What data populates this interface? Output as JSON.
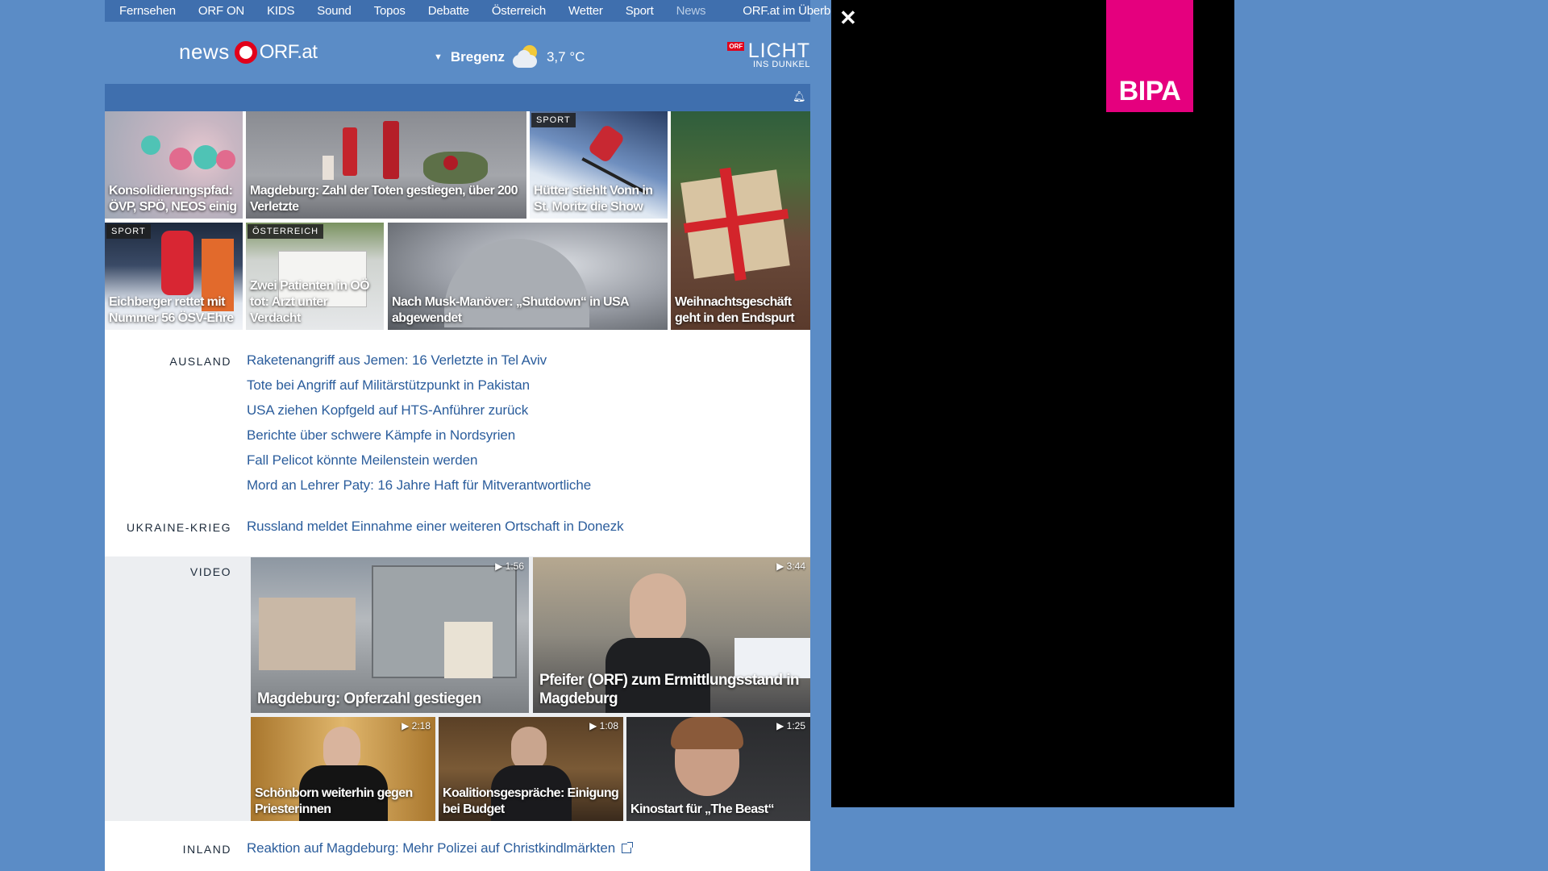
{
  "topnav": {
    "items": [
      "Fernsehen",
      "ORF ON",
      "KIDS",
      "Sound",
      "Topos",
      "Debatte",
      "Österreich",
      "Wetter",
      "Sport",
      "News"
    ],
    "active": "News",
    "overview": "ORF.at im Überblick"
  },
  "header": {
    "logo_news": "news",
    "logo_orfat": "ORF.at",
    "weather_city": "Bregenz",
    "weather_temp": "3,7 °C",
    "weather_icon": "partly-cloudy-icon",
    "campaign_badge": "ORF",
    "campaign_title": "LICHT",
    "campaign_sub": "INS DUNKEL"
  },
  "tiles": [
    {
      "caption": "Konsolidierungspfad: ÖVP, SPÖ, NEOS einig",
      "tag": ""
    },
    {
      "caption": "Magdeburg: Zahl der Toten gestiegen, über 200 Verletzte",
      "tag": ""
    },
    {
      "caption": "Hütter stiehlt Vonn in St. Moritz die Show",
      "tag": "SPORT"
    },
    {
      "caption": "Weihnachtsgeschäft geht in den Endspurt",
      "tag": ""
    },
    {
      "caption": "Eichberger rettet mit Nummer 56 ÖSV-Ehre",
      "tag": "SPORT"
    },
    {
      "caption": "Zwei Patienten in OÖ tot: Arzt unter Verdacht",
      "tag": "ÖSTERREICH"
    },
    {
      "caption": "Nach Musk-Manöver: „Shutdown“ in USA abgewendet",
      "tag": ""
    }
  ],
  "sections": {
    "ausland": {
      "label": "AUSLAND",
      "items": [
        "Raketenangriff aus Jemen: 16 Verletzte in Tel Aviv",
        "Tote bei Angriff auf Militärstützpunkt in Pakistan",
        "USA ziehen Kopfgeld auf HTS-Anführer zurück",
        "Berichte über schwere Kämpfe in Nordsyrien",
        "Fall Pelicot könnte Meilenstein werden",
        "Mord an Lehrer Paty: 16 Jahre Haft für Mitverantwortliche"
      ]
    },
    "ukraine": {
      "label": "UKRAINE-KRIEG",
      "items": [
        "Russland meldet Einnahme einer weiteren Ortschaft in Donezk"
      ]
    },
    "video": {
      "label": "VIDEO",
      "items": [
        {
          "caption": "Magdeburg: Opferzahl gestiegen",
          "duration": "▶ 1:56"
        },
        {
          "caption": "Pfeifer (ORF) zum Ermittlungsstand in Magdeburg",
          "duration": "▶ 3:44"
        },
        {
          "caption": "Schönborn weiterhin gegen Priesterinnen",
          "duration": "▶ 2:18"
        },
        {
          "caption": "Koalitionsgespräche: Einigung bei Budget",
          "duration": "▶ 1:08"
        },
        {
          "caption": "Kinostart für „The Beast“",
          "duration": "▶ 1:25"
        }
      ]
    },
    "inland": {
      "label": "INLAND",
      "items": [
        "Reaktion auf Magdeburg: Mehr Polizei auf Christkindlmärkten"
      ]
    }
  },
  "ad": {
    "close_icon": "close-icon",
    "brand": "BIPA",
    "brand_color": "#e5007e"
  },
  "colors": {
    "page_bg": "#5b8cc6",
    "nav_bg": "#3f6fae",
    "link": "#2b5d9c",
    "orf_red": "#e2001a"
  }
}
